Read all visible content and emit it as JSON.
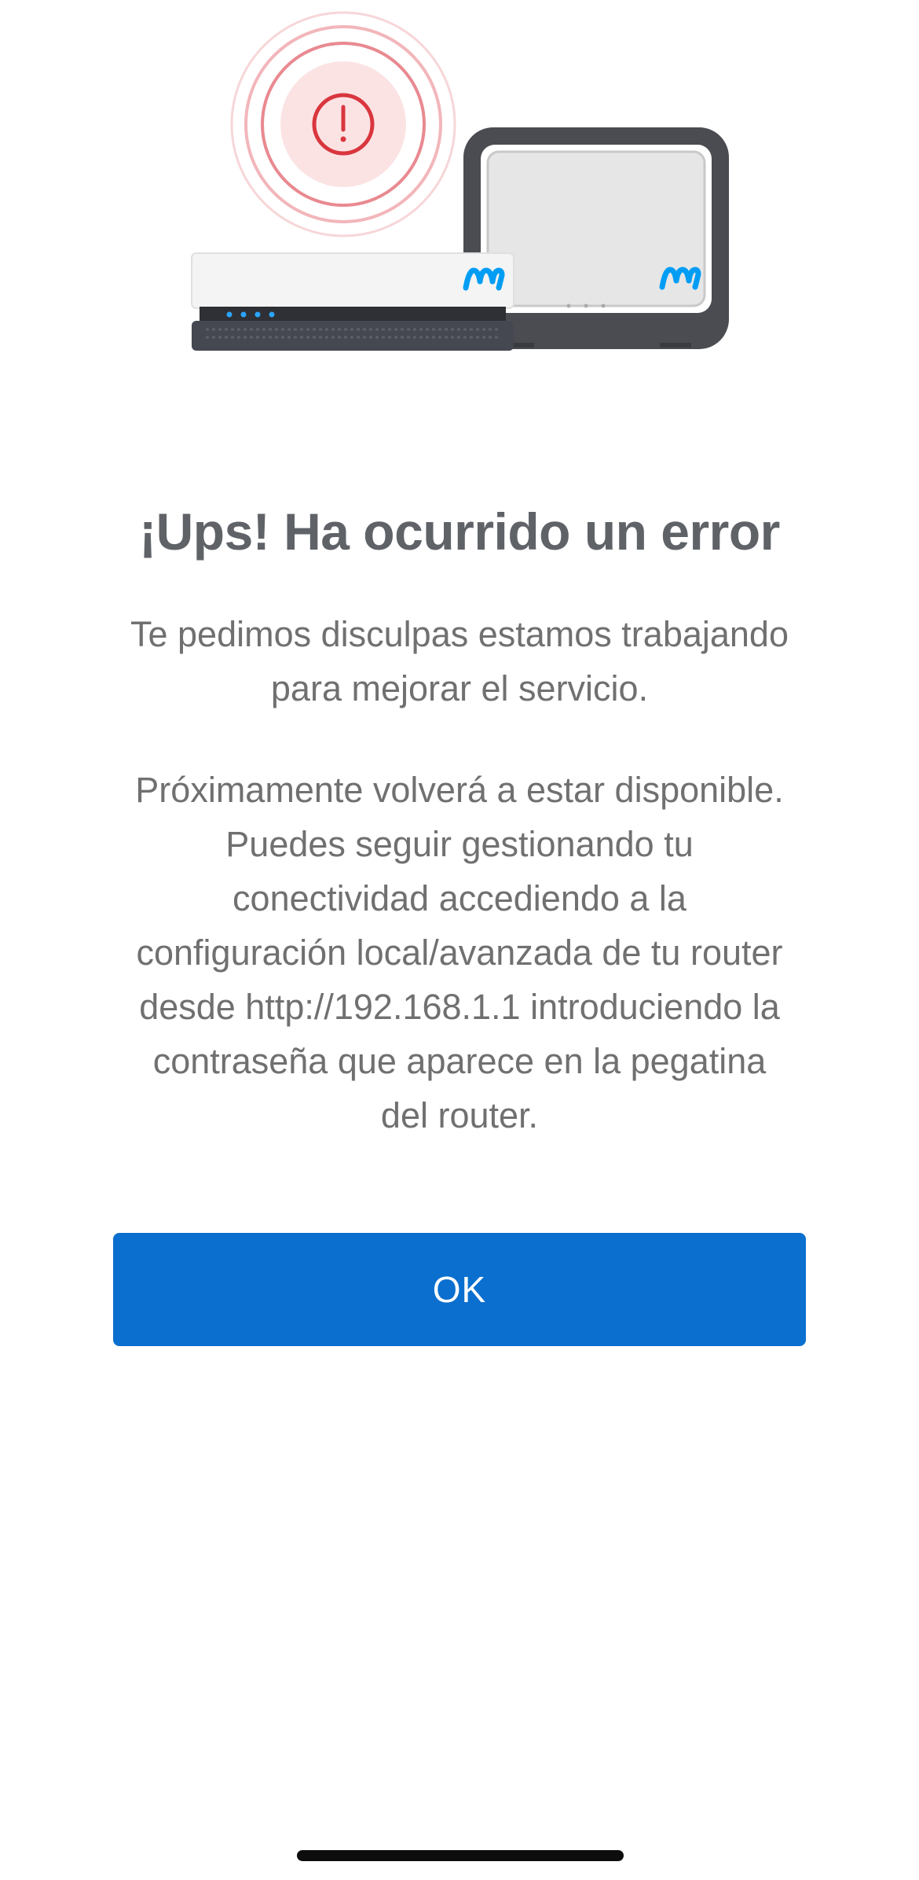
{
  "error_screen": {
    "title": "¡Ups! Ha ocurrido un error",
    "subtitle_lines": [
      "Te pedimos disculpas estamos trabajando",
      "para mejorar el servicio."
    ],
    "body_lines": [
      "Próximamente volverá a estar disponible.",
      "Puedes seguir gestionando tu",
      "conectividad accediendo a la",
      "configuración local/avanzada de tu router",
      "desde  http://192.168.1.1 introduciendo la",
      "contraseña que aparece en la pegatina",
      "del router."
    ],
    "ok_label": "OK"
  },
  "illustration": {
    "alert_icon": "exclamation-circle-icon",
    "devices": [
      "router",
      "wifi-extender"
    ],
    "brand_logo": "movistar-m-logo"
  },
  "colors": {
    "accent_button": "#0a6fcf",
    "alert_red": "#d9363e",
    "brand_blue": "#019df4",
    "text_gray": "#707070",
    "title_gray": "#5f6368"
  }
}
